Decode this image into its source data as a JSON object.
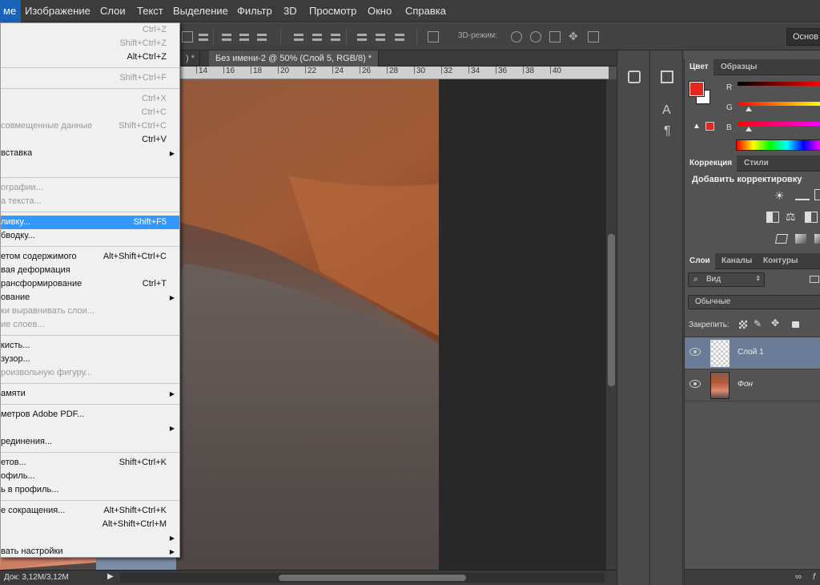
{
  "menubar": {
    "items": [
      "ме",
      "Изображение",
      "Слои",
      "Текст",
      "Выделение",
      "Фильтр",
      "3D",
      "Просмотр",
      "Окно",
      "Справка"
    ]
  },
  "optbar": {
    "mode3d_label": "3D-режим:",
    "workspace_label": "Основ"
  },
  "tabs": [
    {
      "label": ") *"
    },
    {
      "label": "Без имени-2 @ 50% (Слой 5, RGB/8) *"
    }
  ],
  "ruler": {
    "ticks": [
      "14",
      "16",
      "18",
      "20",
      "22",
      "24",
      "26",
      "28",
      "30",
      "32",
      "34",
      "36",
      "38",
      "40"
    ]
  },
  "status": {
    "doc": "Док: 3,12M/3,12M"
  },
  "edit_menu": [
    {
      "type": "item",
      "label": "",
      "shortcut": "Ctrl+Z",
      "disabled": true
    },
    {
      "type": "item",
      "label": "",
      "shortcut": "Shift+Ctrl+Z",
      "disabled": true
    },
    {
      "type": "item",
      "label": "",
      "shortcut": "Alt+Ctrl+Z"
    },
    {
      "type": "sep"
    },
    {
      "type": "item",
      "label": "",
      "shortcut": "Shift+Ctrl+F",
      "disabled": true
    },
    {
      "type": "sep"
    },
    {
      "type": "item",
      "label": "",
      "shortcut": "Ctrl+X",
      "disabled": true
    },
    {
      "type": "item",
      "label": "",
      "shortcut": "Ctrl+C",
      "disabled": true
    },
    {
      "type": "item",
      "label": "совмещенные данные",
      "shortcut": "Shift+Ctrl+C",
      "disabled": true
    },
    {
      "type": "item",
      "label": "",
      "shortcut": "Ctrl+V"
    },
    {
      "type": "item",
      "label": "вставка",
      "submenu": true
    },
    {
      "type": "item",
      "label": ""
    },
    {
      "type": "sep"
    },
    {
      "type": "item",
      "label": "ографии...",
      "disabled": true
    },
    {
      "type": "item",
      "label": "а текста...",
      "disabled": true
    },
    {
      "type": "sep"
    },
    {
      "type": "item",
      "label": "ливку...",
      "shortcut": "Shift+F5",
      "highlighted": true
    },
    {
      "type": "item",
      "label": "бводку..."
    },
    {
      "type": "sep"
    },
    {
      "type": "item",
      "label": "етом содержимого",
      "shortcut": "Alt+Shift+Ctrl+C"
    },
    {
      "type": "item",
      "label": "вая деформация"
    },
    {
      "type": "item",
      "label": "рансформирование",
      "shortcut": "Ctrl+T"
    },
    {
      "type": "item",
      "label": "ование",
      "submenu": true
    },
    {
      "type": "item",
      "label": "ки выравнивать слои...",
      "disabled": true
    },
    {
      "type": "item",
      "label": "ие слоев...",
      "disabled": true
    },
    {
      "type": "sep"
    },
    {
      "type": "item",
      "label": "кисть..."
    },
    {
      "type": "item",
      "label": "зузор..."
    },
    {
      "type": "item",
      "label": "роизвольную фигуру...",
      "disabled": true
    },
    {
      "type": "sep"
    },
    {
      "type": "item",
      "label": "амяти",
      "submenu": true
    },
    {
      "type": "sep"
    },
    {
      "type": "item",
      "label": "метров Adobe PDF..."
    },
    {
      "type": "item",
      "label": "",
      "submenu": true
    },
    {
      "type": "item",
      "label": "рединения..."
    },
    {
      "type": "sep"
    },
    {
      "type": "item",
      "label": "етов...",
      "shortcut": "Shift+Ctrl+K"
    },
    {
      "type": "item",
      "label": "офиль..."
    },
    {
      "type": "item",
      "label": "ь в профиль..."
    },
    {
      "type": "sep"
    },
    {
      "type": "item",
      "label": "е сокращения...",
      "shortcut": "Alt+Shift+Ctrl+K"
    },
    {
      "type": "item",
      "label": "",
      "shortcut": "Alt+Shift+Ctrl+M"
    },
    {
      "type": "item",
      "label": "",
      "submenu": true
    },
    {
      "type": "item",
      "label": "вать настройки",
      "submenu": true
    }
  ],
  "panels": {
    "color": {
      "tabs": [
        "Цвет",
        "Образцы"
      ],
      "channels": [
        "R",
        "G",
        "B"
      ],
      "fg_color": "#e8261c",
      "bg_color": "#ffffff"
    },
    "adjust": {
      "tabs": [
        "Коррекция",
        "Стили"
      ],
      "heading": "Добавить корректировку"
    },
    "layers": {
      "tabs": [
        "Слои",
        "Каналы",
        "Контуры"
      ],
      "filter_label": "Вид",
      "blend_mode": "Обычные",
      "lock_label": "Закрепить:",
      "items": [
        {
          "name": "Слой 1",
          "selected": true,
          "italic": false
        },
        {
          "name": "Фон",
          "selected": false,
          "italic": true
        }
      ]
    }
  },
  "colors": {
    "menu_highlight": "#3399ff",
    "active_menu": "#1c62b8",
    "layer_selected": "#6a7c98"
  }
}
